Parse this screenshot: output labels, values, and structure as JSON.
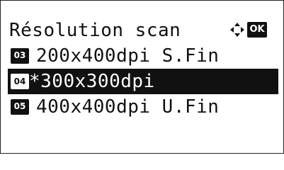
{
  "screen": {
    "title": "Résolution scan",
    "ok_label": "OK"
  },
  "options": [
    {
      "number": "03",
      "label": "200x400dpi S.Fin",
      "selected": false
    },
    {
      "number": "04",
      "label": "*300x300dpi",
      "selected": true
    },
    {
      "number": "05",
      "label": "400x400dpi U.Fin",
      "selected": false
    }
  ],
  "icons": {
    "nav": "four-way-arrow-icon",
    "ok": "ok-key-icon"
  },
  "colors": {
    "foreground": "#111111",
    "background": "#ffffff"
  }
}
